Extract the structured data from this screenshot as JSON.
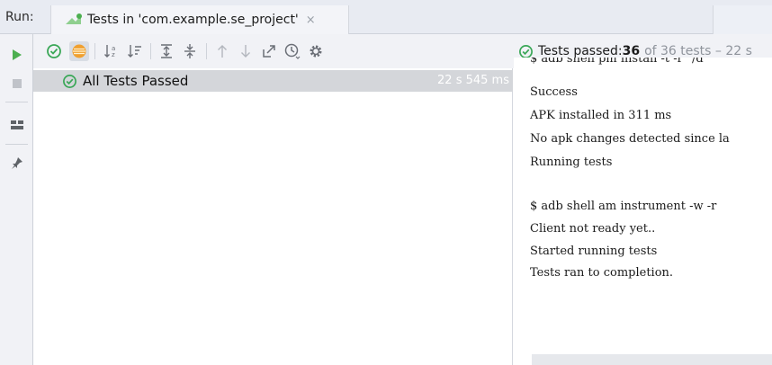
{
  "header": {
    "run_label": "Run:",
    "tab_label": "Tests in 'com.example.se_project'",
    "close_glyph": "×"
  },
  "tree": {
    "root_label": "All Tests Passed",
    "root_duration": "22 s 545 ms"
  },
  "status": {
    "prefix": "Tests passed: ",
    "passed": "36",
    "suffix": "of 36 tests – 22 s"
  },
  "console": {
    "lines": [
      "$ adb shell pm install -t -r \"/d",
      "Success",
      "APK installed in 311 ms",
      "No apk changes detected since la",
      "Running tests",
      "",
      "$ adb shell am instrument -w -r",
      "Client not ready yet..",
      "Started running tests",
      "Tests ran to completion."
    ]
  },
  "colors": {
    "pass_green": "#3aa757",
    "run_green": "#4caf50",
    "selection": "#d4d6da",
    "highlight_orange": "#f0a030"
  },
  "icons": {
    "run": "play-icon",
    "stop": "stop-icon",
    "layout": "layout-icon",
    "pin": "pin-icon",
    "show_passed": "check-circle-icon",
    "show_ignored": "ignored-icon",
    "sort_alpha": "sort-alpha-icon",
    "sort_duration": "sort-duration-icon",
    "expand_all": "expand-all-icon",
    "collapse_all": "collapse-all-icon",
    "prev_failed": "arrow-up-icon",
    "next_failed": "arrow-down-icon",
    "export": "export-icon",
    "history": "clock-icon",
    "settings": "gear-icon"
  }
}
